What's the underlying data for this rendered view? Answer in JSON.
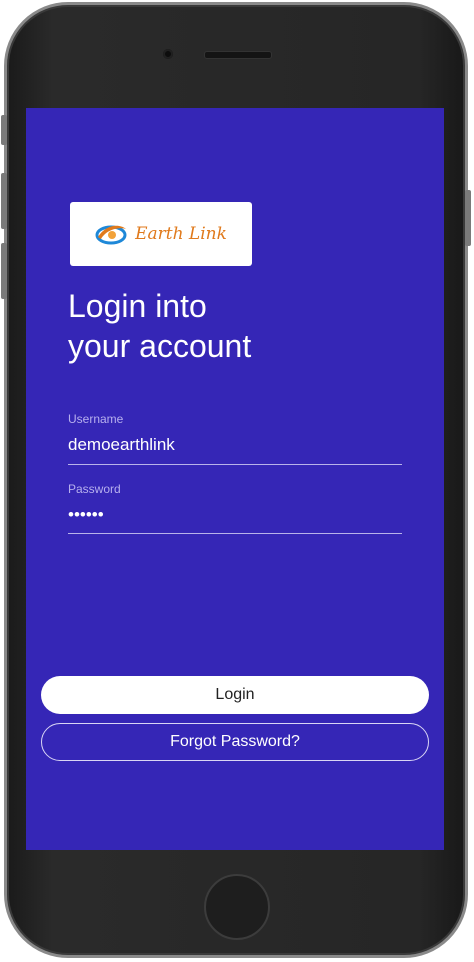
{
  "brand": {
    "name": "Earth Link",
    "logo_icon": "earth-swoosh-icon",
    "colors": {
      "primary": "#3526b6",
      "logo_orange": "#e07a1c",
      "logo_blue": "#1e88d8"
    }
  },
  "heading": {
    "line1": "Login into",
    "line2": "your account"
  },
  "form": {
    "username": {
      "label": "Username",
      "value": "demoearthlink"
    },
    "password": {
      "label": "Password",
      "value": "••••••"
    }
  },
  "actions": {
    "login_label": "Login",
    "forgot_label": "Forgot Password?"
  }
}
